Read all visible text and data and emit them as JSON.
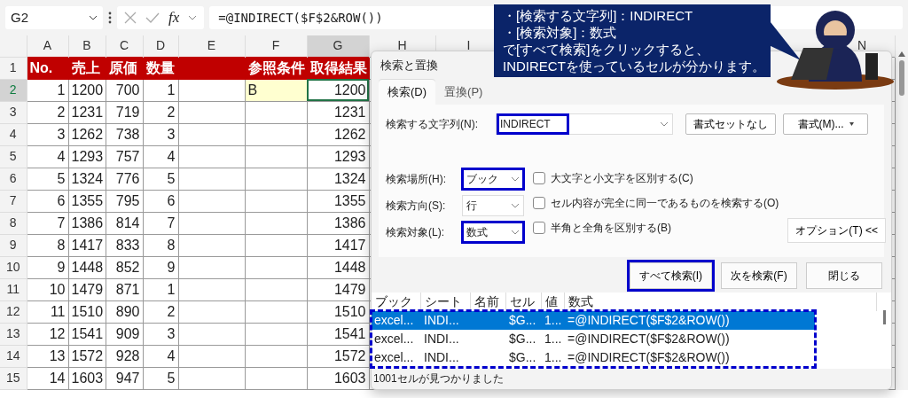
{
  "formula_bar": {
    "name_box": "G2",
    "fx": "fx",
    "formula": "=@INDIRECT($F$2&ROW())"
  },
  "sheet": {
    "columns": [
      {
        "label": "A",
        "selected": false
      },
      {
        "label": "B",
        "selected": false
      },
      {
        "label": "C",
        "selected": false
      },
      {
        "label": "D",
        "selected": false
      },
      {
        "label": "E",
        "selected": false
      },
      {
        "label": "F",
        "selected": false
      },
      {
        "label": "G",
        "selected": true
      },
      {
        "label": "H",
        "selected": false
      },
      {
        "label": "I",
        "selected": false
      },
      {
        "label": "N",
        "selected": false,
        "gap_before": true
      }
    ],
    "rows": [
      {
        "number": "1",
        "selected": false,
        "cells": [
          {
            "text": "No.",
            "kind": "header"
          },
          {
            "text": "売上",
            "kind": "header"
          },
          {
            "text": "原価",
            "kind": "header"
          },
          {
            "text": "数量",
            "kind": "header"
          },
          {
            "kind": "header"
          },
          {
            "text": "参照条件",
            "kind": "header"
          },
          {
            "text": "取得結果",
            "kind": "header"
          }
        ]
      },
      {
        "number": "2",
        "selected": true,
        "cells": [
          {
            "text": "1",
            "kind": "number"
          },
          {
            "text": "1200",
            "kind": "number"
          },
          {
            "text": "700",
            "kind": "number"
          },
          {
            "text": "1",
            "kind": "number"
          },
          {
            "kind": "blank"
          },
          {
            "text": "B",
            "kind": "input"
          },
          {
            "text": "1200",
            "kind": "number",
            "selected": true
          }
        ]
      },
      {
        "number": "3",
        "selected": false,
        "cells": [
          {
            "text": "2",
            "kind": "number"
          },
          {
            "text": "1231",
            "kind": "number"
          },
          {
            "text": "719",
            "kind": "number"
          },
          {
            "text": "2",
            "kind": "number"
          },
          {
            "kind": "blank"
          },
          {
            "kind": "blank"
          },
          {
            "text": "1231",
            "kind": "number"
          }
        ]
      },
      {
        "number": "4",
        "selected": false,
        "cells": [
          {
            "text": "3",
            "kind": "number"
          },
          {
            "text": "1262",
            "kind": "number"
          },
          {
            "text": "738",
            "kind": "number"
          },
          {
            "text": "3",
            "kind": "number"
          },
          {
            "kind": "blank"
          },
          {
            "kind": "blank"
          },
          {
            "text": "1262",
            "kind": "number"
          }
        ]
      },
      {
        "number": "5",
        "selected": false,
        "cells": [
          {
            "text": "4",
            "kind": "number"
          },
          {
            "text": "1293",
            "kind": "number"
          },
          {
            "text": "757",
            "kind": "number"
          },
          {
            "text": "4",
            "kind": "number"
          },
          {
            "kind": "blank"
          },
          {
            "kind": "blank"
          },
          {
            "text": "1293",
            "kind": "number"
          }
        ]
      },
      {
        "number": "6",
        "selected": false,
        "cells": [
          {
            "text": "5",
            "kind": "number"
          },
          {
            "text": "1324",
            "kind": "number"
          },
          {
            "text": "776",
            "kind": "number"
          },
          {
            "text": "5",
            "kind": "number"
          },
          {
            "kind": "blank"
          },
          {
            "kind": "blank"
          },
          {
            "text": "1324",
            "kind": "number"
          }
        ]
      },
      {
        "number": "7",
        "selected": false,
        "cells": [
          {
            "text": "6",
            "kind": "number"
          },
          {
            "text": "1355",
            "kind": "number"
          },
          {
            "text": "795",
            "kind": "number"
          },
          {
            "text": "6",
            "kind": "number"
          },
          {
            "kind": "blank"
          },
          {
            "kind": "blank"
          },
          {
            "text": "1355",
            "kind": "number"
          }
        ]
      },
      {
        "number": "8",
        "selected": false,
        "cells": [
          {
            "text": "7",
            "kind": "number"
          },
          {
            "text": "1386",
            "kind": "number"
          },
          {
            "text": "814",
            "kind": "number"
          },
          {
            "text": "7",
            "kind": "number"
          },
          {
            "kind": "blank"
          },
          {
            "kind": "blank"
          },
          {
            "text": "1386",
            "kind": "number"
          }
        ]
      },
      {
        "number": "9",
        "selected": false,
        "cells": [
          {
            "text": "8",
            "kind": "number"
          },
          {
            "text": "1417",
            "kind": "number"
          },
          {
            "text": "833",
            "kind": "number"
          },
          {
            "text": "8",
            "kind": "number"
          },
          {
            "kind": "blank"
          },
          {
            "kind": "blank"
          },
          {
            "text": "1417",
            "kind": "number"
          }
        ]
      },
      {
        "number": "10",
        "selected": false,
        "cells": [
          {
            "text": "9",
            "kind": "number"
          },
          {
            "text": "1448",
            "kind": "number"
          },
          {
            "text": "852",
            "kind": "number"
          },
          {
            "text": "9",
            "kind": "number"
          },
          {
            "kind": "blank"
          },
          {
            "kind": "blank"
          },
          {
            "text": "1448",
            "kind": "number"
          }
        ]
      },
      {
        "number": "11",
        "selected": false,
        "cells": [
          {
            "text": "10",
            "kind": "number"
          },
          {
            "text": "1479",
            "kind": "number"
          },
          {
            "text": "871",
            "kind": "number"
          },
          {
            "text": "1",
            "kind": "number"
          },
          {
            "kind": "blank"
          },
          {
            "kind": "blank"
          },
          {
            "text": "1479",
            "kind": "number"
          }
        ]
      },
      {
        "number": "12",
        "selected": false,
        "cells": [
          {
            "text": "11",
            "kind": "number"
          },
          {
            "text": "1510",
            "kind": "number"
          },
          {
            "text": "890",
            "kind": "number"
          },
          {
            "text": "2",
            "kind": "number"
          },
          {
            "kind": "blank"
          },
          {
            "kind": "blank"
          },
          {
            "text": "1510",
            "kind": "number"
          }
        ]
      },
      {
        "number": "13",
        "selected": false,
        "cells": [
          {
            "text": "12",
            "kind": "number"
          },
          {
            "text": "1541",
            "kind": "number"
          },
          {
            "text": "909",
            "kind": "number"
          },
          {
            "text": "3",
            "kind": "number"
          },
          {
            "kind": "blank"
          },
          {
            "kind": "blank"
          },
          {
            "text": "1541",
            "kind": "number"
          }
        ]
      },
      {
        "number": "14",
        "selected": false,
        "cells": [
          {
            "text": "13",
            "kind": "number"
          },
          {
            "text": "1572",
            "kind": "number"
          },
          {
            "text": "928",
            "kind": "number"
          },
          {
            "text": "4",
            "kind": "number"
          },
          {
            "kind": "blank"
          },
          {
            "kind": "blank"
          },
          {
            "text": "1572",
            "kind": "number"
          }
        ]
      },
      {
        "number": "15",
        "selected": false,
        "cells": [
          {
            "text": "14",
            "kind": "number"
          },
          {
            "text": "1603",
            "kind": "number"
          },
          {
            "text": "947",
            "kind": "number"
          },
          {
            "text": "5",
            "kind": "number"
          },
          {
            "kind": "blank"
          },
          {
            "kind": "blank"
          },
          {
            "text": "1603",
            "kind": "number"
          }
        ]
      }
    ]
  },
  "dialog": {
    "title": "検索と置換",
    "tabs": [
      {
        "label": "検索(D)",
        "selected": true
      },
      {
        "label": "置換(P)",
        "selected": false
      }
    ],
    "find": {
      "label": "検索する文字列(N):",
      "value": "INDIRECT",
      "annotated": true
    },
    "format_buttons": [
      {
        "label": "書式セットなし",
        "dropdown": false
      },
      {
        "label": "書式(M)...",
        "dropdown": true
      }
    ],
    "options": [
      {
        "label": "検索場所(H):",
        "value": "ブック",
        "annotated": true
      },
      {
        "label": "検索方向(S):",
        "value": "行",
        "annotated": false
      },
      {
        "label": "検索対象(L):",
        "value": "数式",
        "annotated": true
      }
    ],
    "checkboxes": [
      {
        "label": "大文字と小文字を区別する(C)",
        "checked": false
      },
      {
        "label": "セル内容が完全に同一であるものを検索する(O)",
        "checked": false
      },
      {
        "label": "半角と全角を区別する(B)",
        "checked": false
      }
    ],
    "options_button": "オプション(T) <<",
    "buttons": [
      {
        "label": "すべて検索(I)",
        "annotated": true
      },
      {
        "label": "次を検索(F)",
        "annotated": false
      },
      {
        "label": "閉じる",
        "annotated": false
      }
    ],
    "results": {
      "annotated": true,
      "columns": [
        "ブック",
        "シート",
        "名前",
        "セル",
        "値",
        "数式"
      ],
      "rows": [
        {
          "book": "excel...",
          "sheet": "INDI...",
          "cell": "$G...",
          "value": "1...",
          "formula": "=@INDIRECT($F$2&ROW())",
          "selected": true
        },
        {
          "book": "excel...",
          "sheet": "INDI...",
          "cell": "$G...",
          "value": "1...",
          "formula": "=@INDIRECT($F$2&ROW())",
          "selected": false
        },
        {
          "book": "excel...",
          "sheet": "INDI...",
          "cell": "$G...",
          "value": "1...",
          "formula": "=@INDIRECT($F$2&ROW())",
          "selected": false
        }
      ]
    },
    "status": "1001セルが見つかりました"
  },
  "callout": {
    "lines": [
      "・[検索する文字列]：INDIRECT",
      "・[検索対象]：数式",
      "で[すべて検索]をクリックすると、",
      "INDIRECTを使っているセルが分かります。"
    ]
  }
}
